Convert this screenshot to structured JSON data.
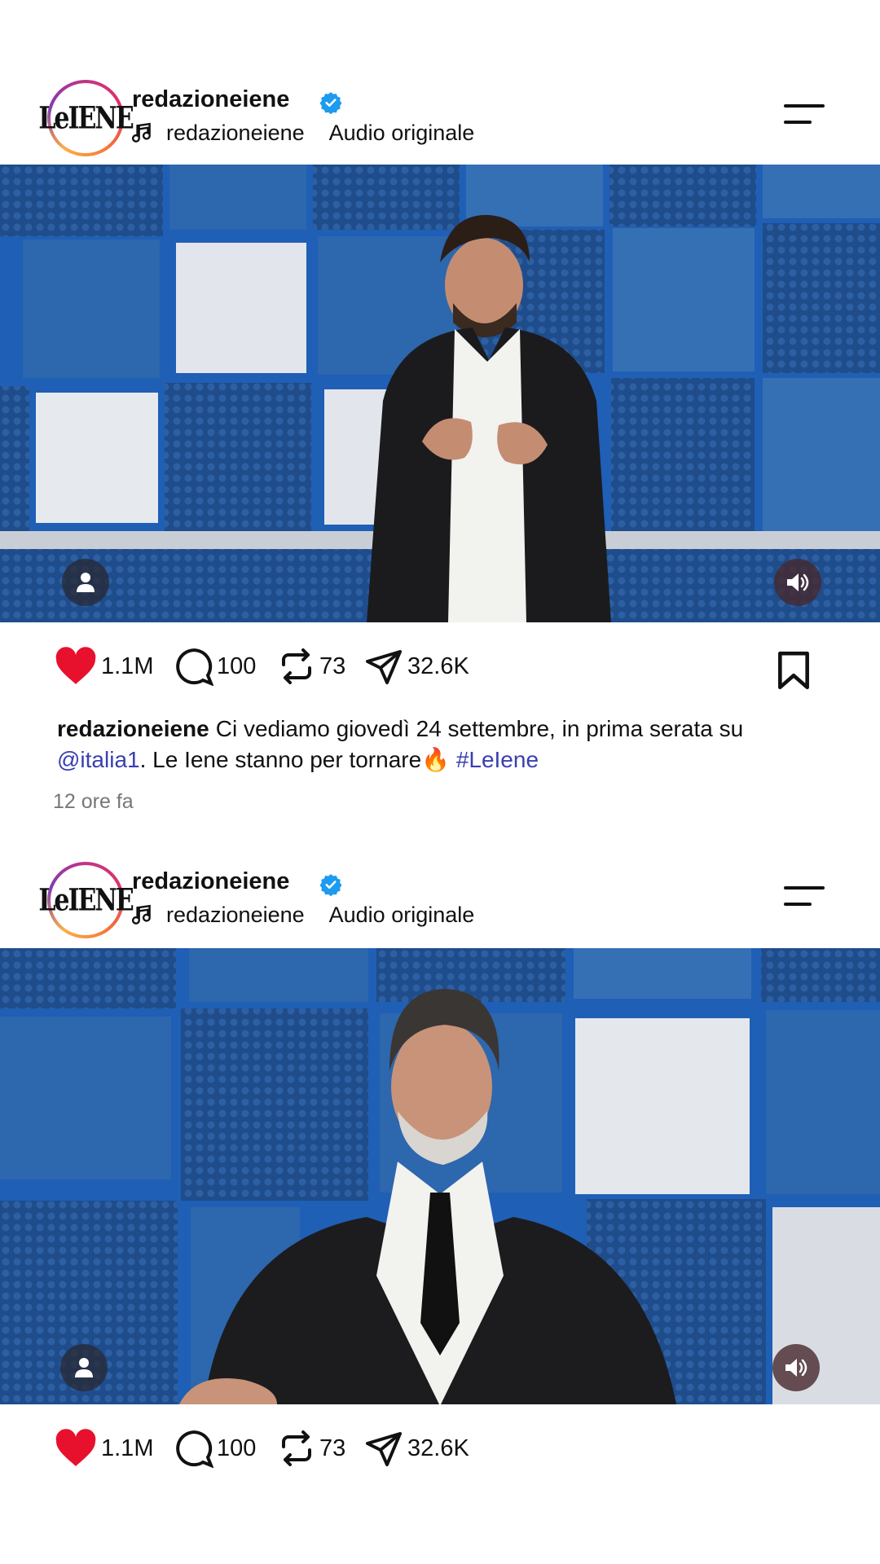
{
  "posts": [
    {
      "username": "redazioneiene",
      "avatar_logo": "LeIENE",
      "audio_user": "redazioneiene",
      "audio_label": "Audio originale",
      "likes": "1.1M",
      "comments": "100",
      "reposts": "73",
      "shares": "32.6K",
      "caption": {
        "user": "redazioneiene",
        "text_1": "Ci vediamo giovedì 24 settembre, in prima serata su ",
        "mention": "@italia1",
        "text_2": ". Le Iene stanno per tornare🔥 ",
        "hashtag": "#LeIene"
      },
      "time": "12 ore fa"
    },
    {
      "username": "redazioneiene",
      "avatar_logo": "LeIENE",
      "audio_user": "redazioneiene",
      "audio_label": "Audio originale",
      "likes": "1.1M",
      "comments": "100",
      "reposts": "73",
      "shares": "32.6K"
    }
  ],
  "icons": {
    "like": "heart-icon",
    "comment": "comment-icon",
    "repost": "repost-icon",
    "share": "send-icon",
    "save": "bookmark-icon",
    "menu": "menu-icon",
    "verified": "verified-badge-icon",
    "audio": "music-note-icon",
    "user_tag": "person-icon",
    "sound": "speaker-icon"
  },
  "colors": {
    "like_red": "#e8112d",
    "verified_blue": "#1d9bf0",
    "link_blue": "#3a3fb0",
    "wall_blue": "#2b5c9e"
  }
}
